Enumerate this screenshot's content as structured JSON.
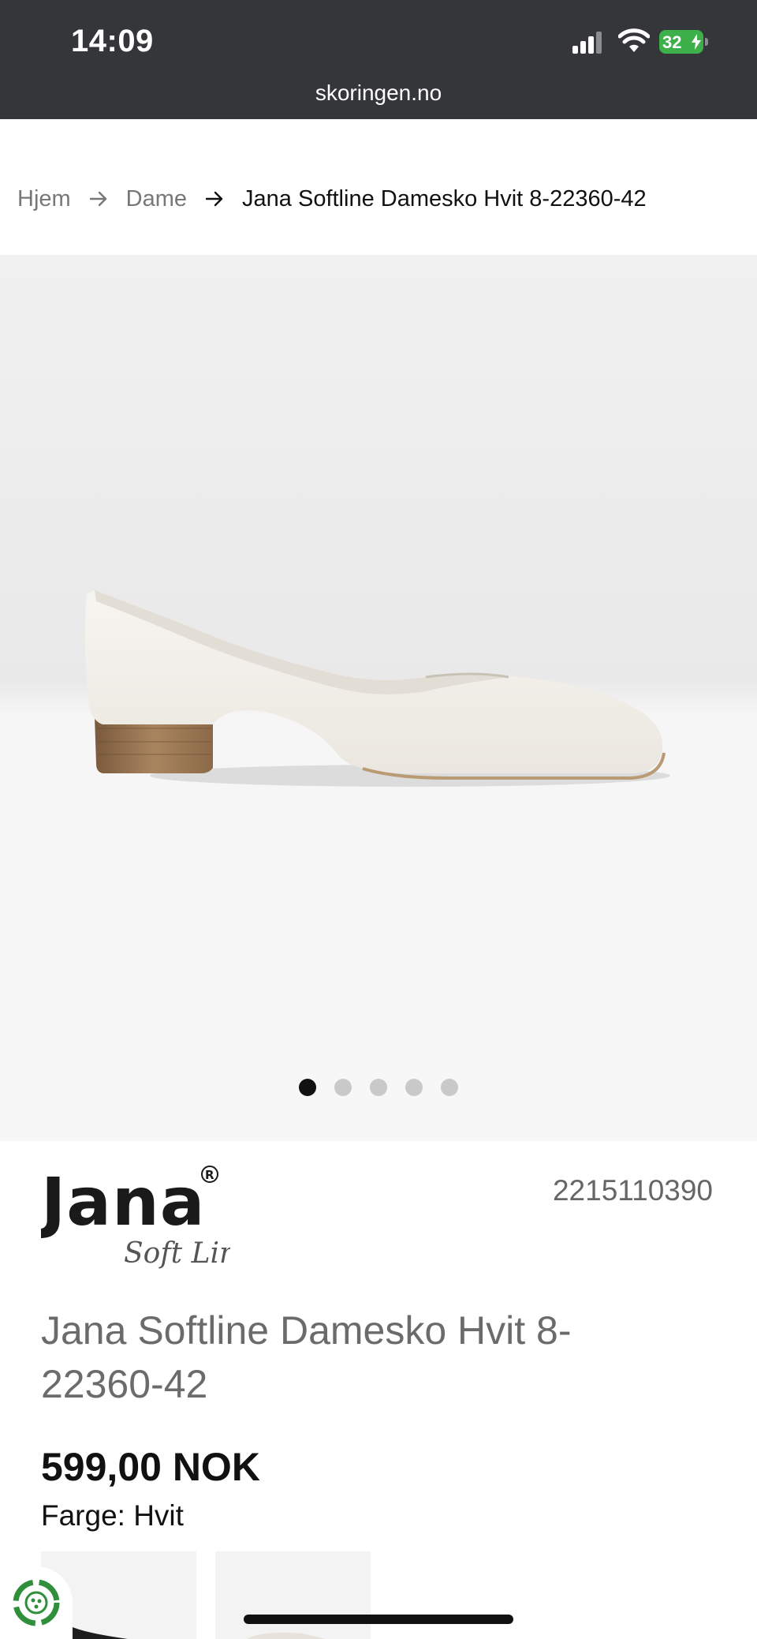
{
  "status_bar": {
    "time": "14:09",
    "battery_level": "32",
    "url": "skoringen.no"
  },
  "breadcrumb": {
    "items": [
      "Hjem",
      "Dame"
    ],
    "current": "Jana Softline Damesko Hvit 8-22360-42"
  },
  "gallery": {
    "image_alt": "white-pump-shoe",
    "slide_count": 5,
    "active_slide": 1
  },
  "product": {
    "brand_name": "Jana",
    "brand_sub": "Soft Line",
    "sku": "2215110390",
    "title": "Jana Softline Damesko Hvit 8-22360-42",
    "price": "599,00 NOK",
    "color_label": "Farge: Hvit"
  },
  "icons": {
    "signal": "cellular-signal-icon",
    "wifi": "wifi-icon",
    "battery": "battery-charging-icon",
    "breadcrumb_separator": "arrow-right-icon",
    "eco_badge": "recycle-badge-icon"
  },
  "colors": {
    "status_bar_bg": "#34363a",
    "battery_green": "#3db04a",
    "active_dot": "#111111",
    "inactive_dot": "#c9c9c9",
    "title_gray": "#6b6b6b"
  }
}
